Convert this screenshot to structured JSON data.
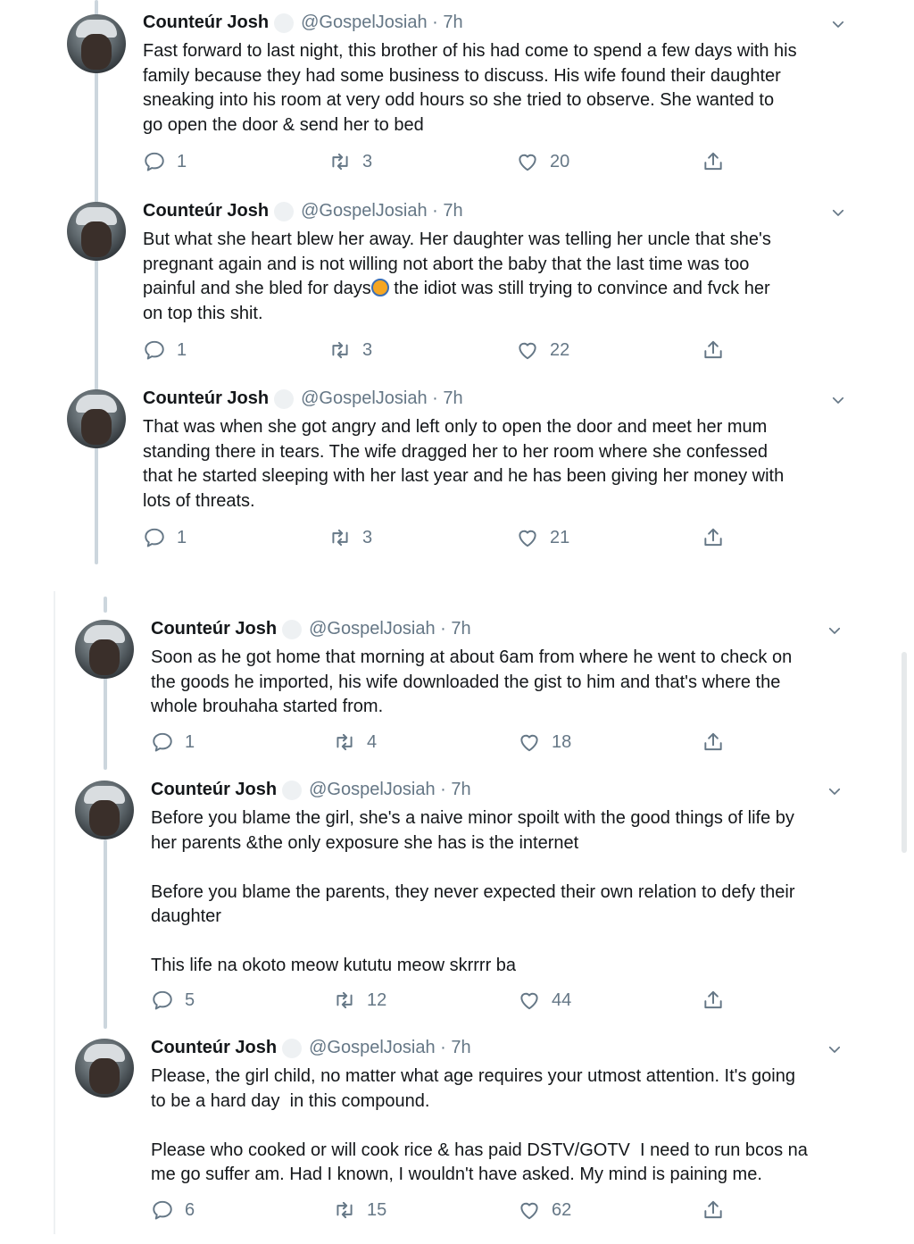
{
  "tweets": [
    {
      "name": "Counteúr Josh",
      "handle": "@GospelJosiah · 7h",
      "text": "Fast forward to last night, this brother of his had come to spend a few days with his\nfamily because they had some business to discuss. His wife found their daughter\nsneaking into his room at very odd hours so she tried to observe. She wanted to\ngo open the door & send her to bed",
      "replies": "1",
      "retweets": "3",
      "likes": "20"
    },
    {
      "name": "Counteúr Josh",
      "handle": "@GospelJosiah · 7h",
      "text_before_emoji": "But what she heart blew her away. Her daughter was telling her uncle that she's\npregnant again and is not willing not abort the baby that the last time was too\npainful and she bled for days",
      "text_after_emoji": " the idiot was still trying to convince and fvck her\non top this shit.",
      "replies": "1",
      "retweets": "3",
      "likes": "22"
    },
    {
      "name": "Counteúr Josh",
      "handle": "@GospelJosiah · 7h",
      "text": "That was when she got angry and left only to open the door and meet her mum\nstanding there in tears. The wife dragged her to her room where she confessed\nthat he started sleeping with her last year and he has been giving her money with\nlots of threats.",
      "replies": "1",
      "retweets": "3",
      "likes": "21"
    },
    {
      "name": "Counteúr Josh",
      "handle": "@GospelJosiah · 7h",
      "text": "Soon as he got home that morning at about 6am from where he went to check on\nthe goods he imported, his wife downloaded the gist to him and that's where the\nwhole brouhaha started from.",
      "replies": "1",
      "retweets": "4",
      "likes": "18"
    },
    {
      "name": "Counteúr Josh",
      "handle": "@GospelJosiah · 7h",
      "text": "Before you blame the girl, she's a naive minor spoilt with the good things of life by\nher parents &the only exposure she has is the internet\n\nBefore you blame the parents, they never expected their own relation to defy their\ndaughter\n\nThis life na okoto meow kututu meow skrrrr ba",
      "replies": "5",
      "retweets": "12",
      "likes": "44"
    },
    {
      "name": "Counteúr Josh",
      "handle": "@GospelJosiah · 7h",
      "text": "Please, the girl child, no matter what age requires your utmost attention. It's going\nto be a hard day  in this compound.\n\nPlease who cooked or will cook rice & has paid DSTV/GOTV  I need to run bcos na\nme go suffer am. Had I known, I wouldn't have asked. My mind is paining me.",
      "replies": "6",
      "retweets": "15",
      "likes": "62"
    }
  ],
  "icons": {
    "reply": "reply-icon",
    "retweet": "retweet-icon",
    "like": "heart-icon",
    "share": "share-icon",
    "more": "chevron-down-icon"
  },
  "colors": {
    "text": "#14171a",
    "secondary": "#657786",
    "thread_line": "#ccd6dd"
  }
}
